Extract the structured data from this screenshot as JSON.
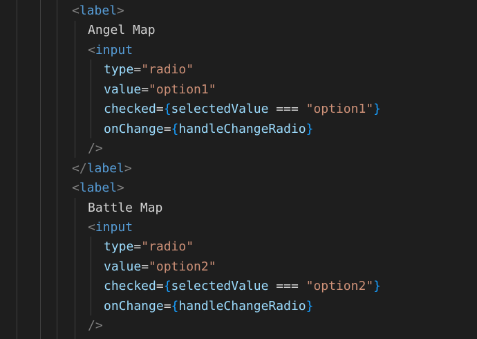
{
  "code": {
    "lines": [
      {
        "tokens": [
          {
            "t": "<",
            "c": "punct"
          },
          {
            "t": "label",
            "c": "tag"
          },
          {
            "t": ">",
            "c": "punct"
          }
        ]
      },
      {
        "tokens": [
          {
            "t": "Angel Map",
            "c": "text"
          }
        ]
      },
      {
        "tokens": [
          {
            "t": "<",
            "c": "punct"
          },
          {
            "t": "input",
            "c": "tag"
          }
        ]
      },
      {
        "tokens": [
          {
            "t": "type",
            "c": "attr"
          },
          {
            "t": "=",
            "c": "op"
          },
          {
            "t": "\"radio\"",
            "c": "str"
          }
        ]
      },
      {
        "tokens": [
          {
            "t": "value",
            "c": "attr"
          },
          {
            "t": "=",
            "c": "op"
          },
          {
            "t": "\"option1\"",
            "c": "str"
          }
        ]
      },
      {
        "tokens": [
          {
            "t": "checked",
            "c": "attr"
          },
          {
            "t": "=",
            "c": "op"
          },
          {
            "t": "{",
            "c": "brace"
          },
          {
            "t": "selectedValue",
            "c": "ident"
          },
          {
            "t": " === ",
            "c": "op"
          },
          {
            "t": "\"option1\"",
            "c": "str"
          },
          {
            "t": "}",
            "c": "brace"
          }
        ]
      },
      {
        "tokens": [
          {
            "t": "onChange",
            "c": "attr"
          },
          {
            "t": "=",
            "c": "op"
          },
          {
            "t": "{",
            "c": "brace"
          },
          {
            "t": "handleChangeRadio",
            "c": "ident"
          },
          {
            "t": "}",
            "c": "brace"
          }
        ]
      },
      {
        "tokens": [
          {
            "t": "/>",
            "c": "punct"
          }
        ]
      },
      {
        "tokens": [
          {
            "t": "</",
            "c": "punct"
          },
          {
            "t": "label",
            "c": "tag"
          },
          {
            "t": ">",
            "c": "punct"
          }
        ]
      },
      {
        "tokens": [
          {
            "t": "<",
            "c": "punct"
          },
          {
            "t": "label",
            "c": "tag"
          },
          {
            "t": ">",
            "c": "punct"
          }
        ]
      },
      {
        "tokens": [
          {
            "t": "Battle Map",
            "c": "text"
          }
        ]
      },
      {
        "tokens": [
          {
            "t": "<",
            "c": "punct"
          },
          {
            "t": "input",
            "c": "tag"
          }
        ]
      },
      {
        "tokens": [
          {
            "t": "type",
            "c": "attr"
          },
          {
            "t": "=",
            "c": "op"
          },
          {
            "t": "\"radio\"",
            "c": "str"
          }
        ]
      },
      {
        "tokens": [
          {
            "t": "value",
            "c": "attr"
          },
          {
            "t": "=",
            "c": "op"
          },
          {
            "t": "\"option2\"",
            "c": "str"
          }
        ]
      },
      {
        "tokens": [
          {
            "t": "checked",
            "c": "attr"
          },
          {
            "t": "=",
            "c": "op"
          },
          {
            "t": "{",
            "c": "brace"
          },
          {
            "t": "selectedValue",
            "c": "ident"
          },
          {
            "t": " === ",
            "c": "op"
          },
          {
            "t": "\"option2\"",
            "c": "str"
          },
          {
            "t": "}",
            "c": "brace"
          }
        ]
      },
      {
        "tokens": [
          {
            "t": "onChange",
            "c": "attr"
          },
          {
            "t": "=",
            "c": "op"
          },
          {
            "t": "{",
            "c": "brace"
          },
          {
            "t": "handleChangeRadio",
            "c": "ident"
          },
          {
            "t": "}",
            "c": "brace"
          }
        ]
      },
      {
        "tokens": [
          {
            "t": "/>",
            "c": "punct"
          }
        ]
      }
    ]
  },
  "colors": {
    "background": "#1e1e1e",
    "tag": "#569cd6",
    "attribute": "#9cdcfe",
    "string": "#ce9178",
    "brace": "#179fff",
    "punctuation": "#808080",
    "text": "#d4d4d4"
  }
}
